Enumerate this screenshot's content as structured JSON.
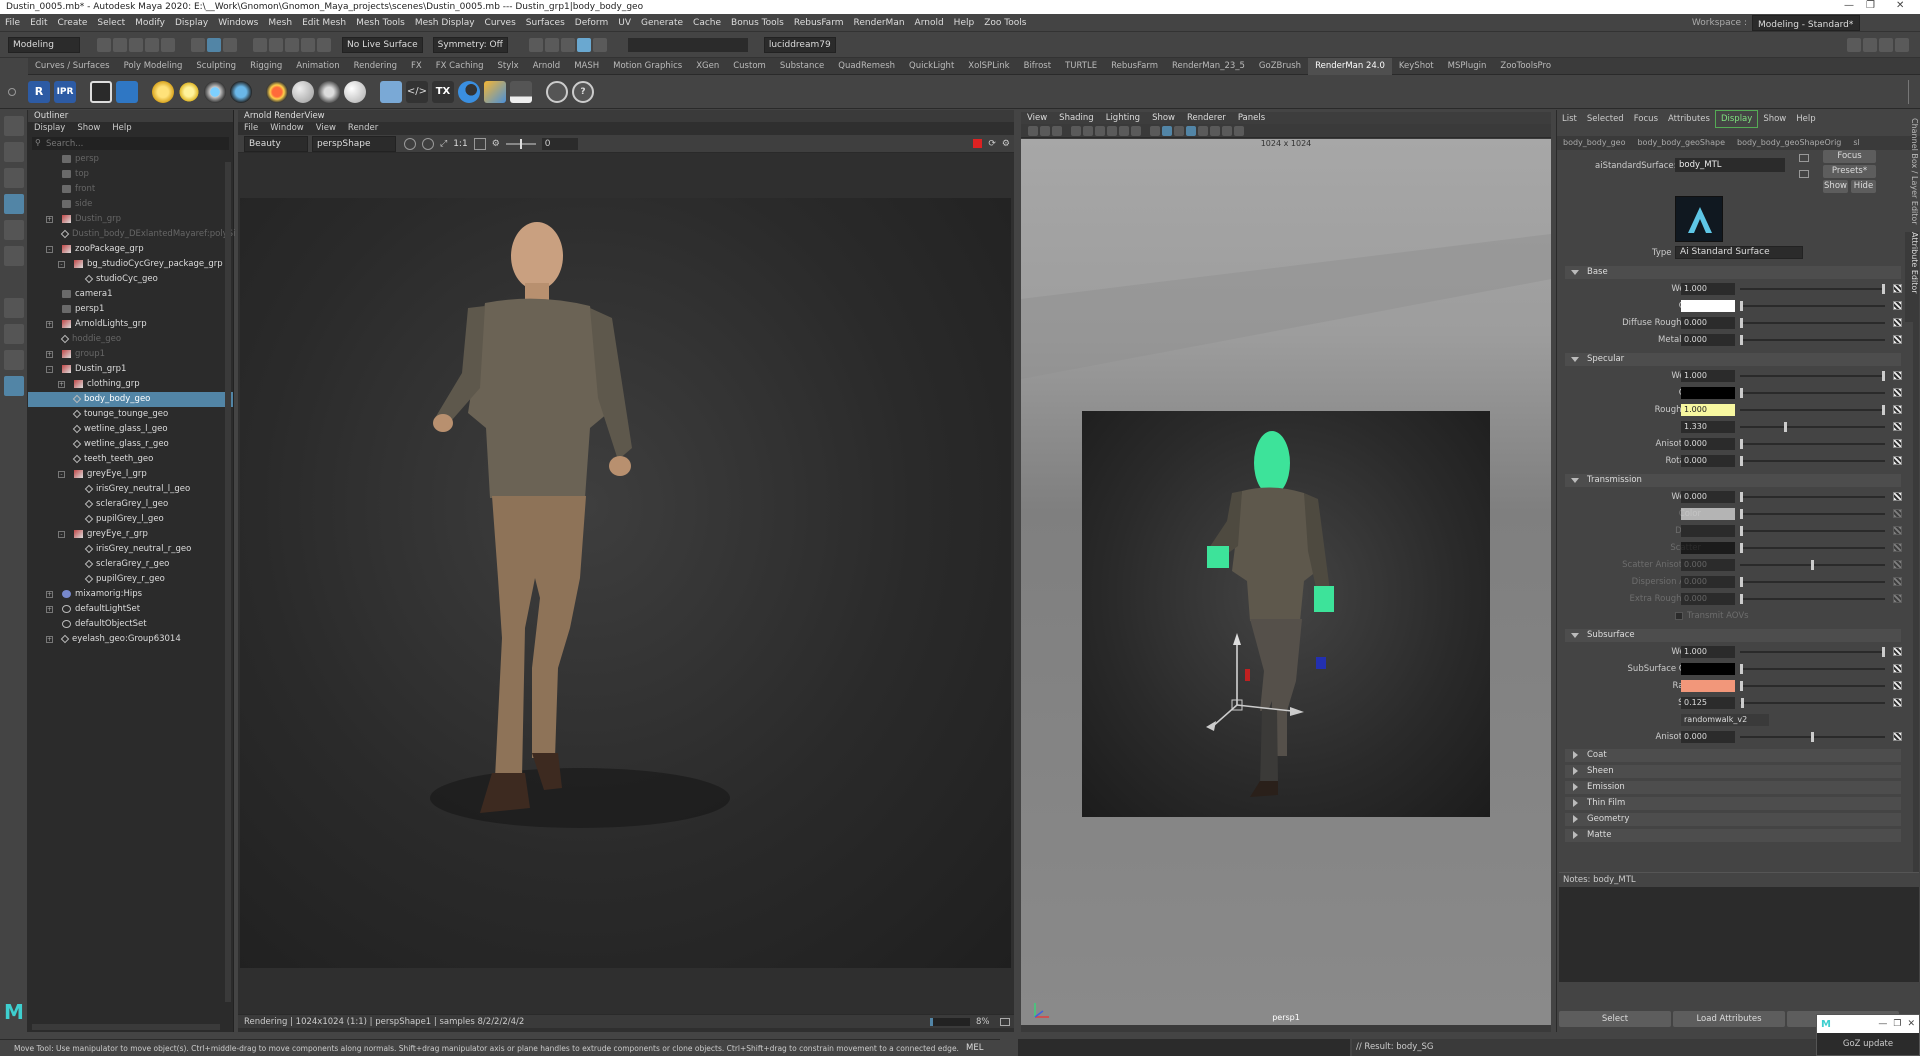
{
  "titlebar": {
    "text": "Dustin_0005.mb* - Autodesk Maya 2020: E:\\__Work\\Gnomon\\Gnomon_Maya_projects\\scenes\\Dustin_0005.mb  ---  Dustin_grp1|body_body_geo"
  },
  "menubar": {
    "items": [
      "File",
      "Edit",
      "Create",
      "Select",
      "Modify",
      "Display",
      "Windows",
      "Mesh",
      "Edit Mesh",
      "Mesh Tools",
      "Mesh Display",
      "Curves",
      "Surfaces",
      "Deform",
      "UV",
      "Generate",
      "Cache",
      "Bonus Tools",
      "RebusFarm",
      "RenderMan",
      "Arnold",
      "Help",
      "Zoo Tools"
    ],
    "workspace_label": "Workspace :",
    "workspace_value": "Modeling - Standard*"
  },
  "statusline": {
    "mode": "Modeling",
    "live_surface": "No Live Surface",
    "symmetry": "Symmetry: Off",
    "user": "luciddream79"
  },
  "shelf_tabs": [
    "Curves / Surfaces",
    "Poly Modeling",
    "Sculpting",
    "Rigging",
    "Animation",
    "Rendering",
    "FX",
    "FX Caching",
    "Stylx",
    "Arnold",
    "MASH",
    "Motion Graphics",
    "XGen",
    "Custom",
    "Substance",
    "QuadRemesh",
    "QuickLight",
    "XolSPLink",
    "Bifrost",
    "TURTLE",
    "RebusFarm",
    "RenderMan_23_5",
    "GoZBrush",
    "RenderMan 24.0",
    "KeyShot",
    "MSPlugin",
    "ZooToolsPro"
  ],
  "shelf_active_tab": "RenderMan 24.0",
  "shelf_buttons": [
    "R",
    "IPR"
  ],
  "outliner": {
    "title": "Outliner",
    "menu": [
      "Display",
      "Show",
      "Help"
    ],
    "search_placeholder": "Search...",
    "items": [
      {
        "label": "persp",
        "indent": 0,
        "dim": true,
        "type": "camera"
      },
      {
        "label": "top",
        "indent": 0,
        "dim": true,
        "type": "camera"
      },
      {
        "label": "front",
        "indent": 0,
        "dim": true,
        "type": "camera"
      },
      {
        "label": "side",
        "indent": 0,
        "dim": true,
        "type": "camera"
      },
      {
        "label": "Dustin_grp",
        "indent": 0,
        "dim": true,
        "type": "group",
        "expand": "+"
      },
      {
        "label": "Dustin_body_DExlantedMayaref:polySi",
        "indent": 0,
        "dim": true,
        "type": "mesh"
      },
      {
        "label": "zooPackage_grp",
        "indent": 0,
        "dim": false,
        "type": "group",
        "expand": "-"
      },
      {
        "label": "bg_studioCycGrey_package_grp",
        "indent": 1,
        "dim": false,
        "type": "group",
        "expand": "-"
      },
      {
        "label": "studioCyc_geo",
        "indent": 2,
        "dim": false,
        "type": "mesh"
      },
      {
        "label": "camera1",
        "indent": 0,
        "dim": false,
        "type": "camera"
      },
      {
        "label": "persp1",
        "indent": 0,
        "dim": false,
        "type": "camera"
      },
      {
        "label": "ArnoldLights_grp",
        "indent": 0,
        "dim": false,
        "type": "group",
        "expand": "+"
      },
      {
        "label": "hoddie_geo",
        "indent": 0,
        "dim": true,
        "type": "mesh"
      },
      {
        "label": "group1",
        "indent": 0,
        "dim": true,
        "type": "group",
        "expand": "+"
      },
      {
        "label": "Dustin_grp1",
        "indent": 0,
        "dim": false,
        "type": "group",
        "expand": "-"
      },
      {
        "label": "clothing_grp",
        "indent": 1,
        "dim": false,
        "type": "group",
        "expand": "+"
      },
      {
        "label": "body_body_geo",
        "indent": 1,
        "dim": false,
        "type": "mesh",
        "selected": true
      },
      {
        "label": "tounge_tounge_geo",
        "indent": 1,
        "dim": false,
        "type": "mesh"
      },
      {
        "label": "wetline_glass_l_geo",
        "indent": 1,
        "dim": false,
        "type": "mesh"
      },
      {
        "label": "wetline_glass_r_geo",
        "indent": 1,
        "dim": false,
        "type": "mesh"
      },
      {
        "label": "teeth_teeth_geo",
        "indent": 1,
        "dim": false,
        "type": "mesh"
      },
      {
        "label": "greyEye_l_grp",
        "indent": 1,
        "dim": false,
        "type": "group",
        "expand": "-"
      },
      {
        "label": "irisGrey_neutral_l_geo",
        "indent": 2,
        "dim": false,
        "type": "mesh"
      },
      {
        "label": "scleraGrey_l_geo",
        "indent": 2,
        "dim": false,
        "type": "mesh"
      },
      {
        "label": "pupilGrey_l_geo",
        "indent": 2,
        "dim": false,
        "type": "mesh"
      },
      {
        "label": "greyEye_r_grp",
        "indent": 1,
        "dim": false,
        "type": "group",
        "expand": "-"
      },
      {
        "label": "irisGrey_neutral_r_geo",
        "indent": 2,
        "dim": false,
        "type": "mesh"
      },
      {
        "label": "scleraGrey_r_geo",
        "indent": 2,
        "dim": false,
        "type": "mesh"
      },
      {
        "label": "pupilGrey_r_geo",
        "indent": 2,
        "dim": false,
        "type": "mesh"
      },
      {
        "label": "mixamorig:Hips",
        "indent": 0,
        "dim": false,
        "type": "joint",
        "expand": "+"
      },
      {
        "label": "defaultLightSet",
        "indent": 0,
        "dim": false,
        "type": "set",
        "expand": "+"
      },
      {
        "label": "defaultObjectSet",
        "indent": 0,
        "dim": false,
        "type": "set"
      },
      {
        "label": "eyelash_geo:Group63014",
        "indent": 0,
        "dim": false,
        "type": "mesh",
        "expand": "+"
      }
    ]
  },
  "render_view": {
    "title": "Arnold RenderView",
    "menu": [
      "File",
      "Window",
      "View",
      "Render"
    ],
    "aov": "Beauty",
    "camera": "perspShape",
    "ratio": "1:1",
    "exposure": "0",
    "status": "Rendering | 1024x1024 (1:1) | perspShape1 | samples 8/2/2/2/4/2",
    "zoom": "8%"
  },
  "viewport": {
    "menu": [
      "View",
      "Shading",
      "Lighting",
      "Show",
      "Renderer",
      "Panels"
    ],
    "resolution": "1024 x 1024",
    "camera_label": "persp1"
  },
  "attribute_editor": {
    "menu": [
      "List",
      "Selected",
      "Focus",
      "Attributes",
      "Display",
      "Show",
      "Help"
    ],
    "menu_highlight": "Display",
    "tabs": [
      "body_body_geo",
      "body_body_geoShape",
      "body_body_geoShapeOrig",
      "sl"
    ],
    "node_type_label": "aiStandardSurface:",
    "node_name": "body_MTL",
    "focus_btn": "Focus",
    "presets_btn": "Presets*",
    "show_btn": "Show",
    "hide_btn": "Hide",
    "type_label": "Type",
    "type_value": "Ai Standard Surface",
    "sections": [
      {
        "name": "Base",
        "open": true,
        "attrs": [
          {
            "label": "Weight",
            "value": "1.000",
            "kind": "slider",
            "level": 1
          },
          {
            "label": "Color",
            "kind": "color",
            "color": "#ffffff"
          },
          {
            "label": "Diffuse Roughness",
            "value": "0.000",
            "kind": "slider",
            "level": 0
          },
          {
            "label": "Metalness",
            "value": "0.000",
            "kind": "slider",
            "level": 0
          }
        ]
      },
      {
        "name": "Specular",
        "open": true,
        "attrs": [
          {
            "label": "Weight",
            "value": "1.000",
            "kind": "slider",
            "level": 1
          },
          {
            "label": "Color",
            "kind": "color",
            "color": "#000000"
          },
          {
            "label": "Roughness",
            "value": "1.000",
            "kind": "slider",
            "level": 1,
            "highlight": true
          },
          {
            "label": "IOR",
            "value": "1.330",
            "kind": "slider",
            "level": 0.31
          },
          {
            "label": "Anisotropy",
            "value": "0.000",
            "kind": "slider",
            "level": 0
          },
          {
            "label": "Rotation",
            "value": "0.000",
            "kind": "slider",
            "level": 0
          }
        ]
      },
      {
        "name": "Transmission",
        "open": true,
        "attrs": [
          {
            "label": "Weight",
            "value": "0.000",
            "kind": "slider",
            "level": 0
          },
          {
            "label": "Color",
            "kind": "color",
            "color": "#ffffff",
            "disabled": true
          },
          {
            "label": "Depth",
            "value": "",
            "kind": "slider",
            "level": 0,
            "disabled": true
          },
          {
            "label": "Scatter",
            "kind": "color",
            "color": "#000000",
            "disabled": true
          },
          {
            "label": "Scatter Anisotropy",
            "value": "0.000",
            "kind": "slider",
            "level": 0.5,
            "disabled": true
          },
          {
            "label": "Dispersion Abbe",
            "value": "0.000",
            "kind": "slider",
            "level": 0,
            "disabled": true
          },
          {
            "label": "Extra Roughness",
            "value": "0.000",
            "kind": "slider",
            "level": 0,
            "disabled": true
          },
          {
            "label": "Transmit AOVs",
            "kind": "check",
            "disabled": true
          }
        ]
      },
      {
        "name": "Subsurface",
        "open": true,
        "attrs": [
          {
            "label": "Weight",
            "value": "1.000",
            "kind": "slider",
            "level": 1
          },
          {
            "label": "SubSurface Color",
            "kind": "color",
            "color": "#000000"
          },
          {
            "label": "Radius",
            "kind": "color",
            "color": "#f2977a"
          },
          {
            "label": "Scale",
            "value": "0.125",
            "kind": "slider",
            "level": 0.01
          },
          {
            "label": "Type",
            "value": "randomwalk_v2",
            "kind": "select"
          },
          {
            "label": "Anisotropy",
            "value": "0.000",
            "kind": "slider",
            "level": 0.5
          }
        ]
      },
      {
        "name": "Coat",
        "open": false,
        "attrs": []
      },
      {
        "name": "Sheen",
        "open": false,
        "attrs": []
      },
      {
        "name": "Emission",
        "open": false,
        "attrs": []
      },
      {
        "name": "Thin Film",
        "open": false,
        "attrs": []
      },
      {
        "name": "Geometry",
        "open": false,
        "attrs": []
      },
      {
        "name": "Matte",
        "open": false,
        "attrs": []
      }
    ],
    "notes_label": "Notes:  body_MTL",
    "select_btn": "Select",
    "load_btn": "Load Attributes",
    "copy_tab_btn": "Copy Tab"
  },
  "side_tabs": [
    "Channel Box / Layer Editor",
    "Attribute Editor"
  ],
  "helpline": {
    "text": "Move Tool: Use manipulator to move object(s). Ctrl+middle-drag to move components along normals. Shift+drag manipulator axis or plane handles to extrude components or clone objects. Ctrl+Shift+drag to constrain movement to a connected edge. Use D or INSERT to change the pivot",
    "mel": "MEL",
    "result": "// Result: body_SG"
  },
  "goz": {
    "label": "GoZ update"
  },
  "colors": {
    "selection": "#5285a6",
    "accent_green": "#3de39a",
    "radius_swatch": "#f2977a",
    "highlight_field": "#f7f7a0"
  }
}
